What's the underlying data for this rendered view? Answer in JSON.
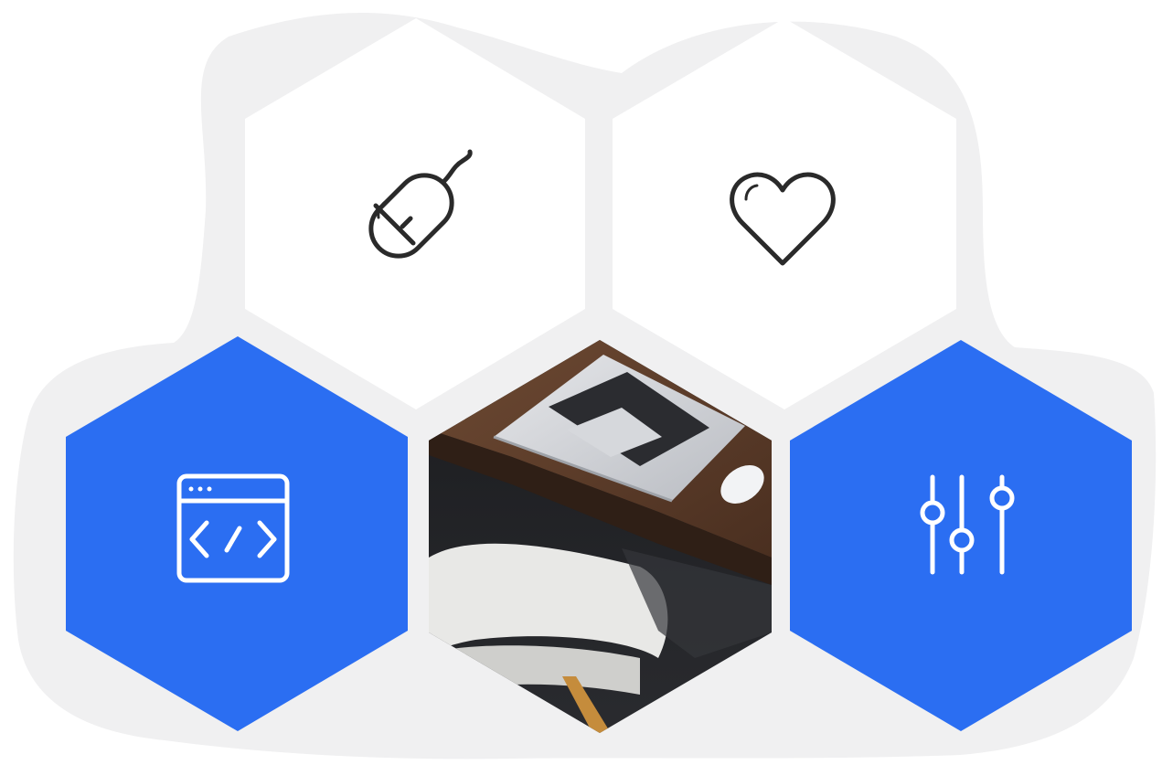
{
  "colors": {
    "page_background": "#ffffff",
    "backdrop": "#f0f0f1",
    "tile_white": "#ffffff",
    "tile_blue": "#2b6ef2",
    "icon_dark": "#2a2a2a",
    "icon_light": "#ffffff"
  },
  "tiles": [
    {
      "name": "mouse-tile",
      "fill": "white",
      "icon": "mouse-icon"
    },
    {
      "name": "heart-tile",
      "fill": "white",
      "icon": "heart-icon"
    },
    {
      "name": "code-window-tile",
      "fill": "blue",
      "icon": "code-window-icon"
    },
    {
      "name": "laptop-photo-tile",
      "fill": "photo",
      "icon": "laptop-desk-photo"
    },
    {
      "name": "sliders-tile",
      "fill": "blue",
      "icon": "sliders-icon"
    }
  ]
}
